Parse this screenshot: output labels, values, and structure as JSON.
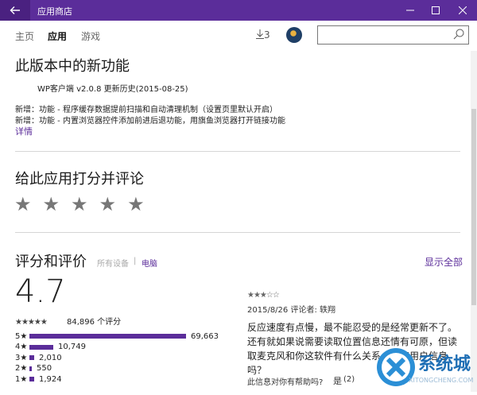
{
  "window": {
    "title": "应用商店"
  },
  "nav": {
    "tabs": [
      {
        "label": "主页"
      },
      {
        "label": "应用"
      },
      {
        "label": "游戏"
      }
    ],
    "downloads_count": "3"
  },
  "whats_new": {
    "heading": "此版本中的新功能",
    "version_line": "WP客户端 v2.0.8 更新历史(2015-08-25)",
    "items": [
      "新增：功能  -   程序缓存数据提前扫描和自动清理机制（设置页里默认开启）",
      "新增：功能  -   内置浏览器控件添加前进后退功能，用旗鱼浏览器打开链接功能"
    ],
    "details_link": "详情"
  },
  "rate": {
    "heading": "给此应用打分并评论",
    "stars": [
      "★",
      "★",
      "★",
      "★",
      "★"
    ]
  },
  "ratings": {
    "heading": "评分和评价",
    "filter_all": "所有设备",
    "separator": "|",
    "filter_pc": "电脑",
    "show_all": "显示全部",
    "average": "4.7",
    "stars_display": "★★★★★",
    "total": "84,896 个评分",
    "distribution": [
      {
        "label": "5★",
        "count": "69,663",
        "fraction": 0.82
      },
      {
        "label": "4★",
        "count": "10,749",
        "fraction": 0.127
      },
      {
        "label": "3★",
        "count": "2,010",
        "fraction": 0.024
      },
      {
        "label": "2★",
        "count": "550",
        "fraction": 0.006
      },
      {
        "label": "1★",
        "count": "1,924",
        "fraction": 0.023
      }
    ]
  },
  "review": {
    "stars": "★★★☆☆",
    "meta": "2015/8/26 评论者: 轶翔",
    "body": "反应速度有点慢，最不能忍受的是经常更新不了。还有就如果说需要读取位置信息还情有可原，但读取麦克风和你这软件有什么关系，盗取用户信息吗？",
    "helpful_prompt": "此信息对你有帮助吗?",
    "yes_label": "是",
    "yes_count": "(2)"
  },
  "watermark": {
    "text": "系统城",
    "subtext": "XITONGCHENG.COM"
  },
  "colors": {
    "accent": "#5b2d9a",
    "titlebar": "#5b2d9a"
  }
}
